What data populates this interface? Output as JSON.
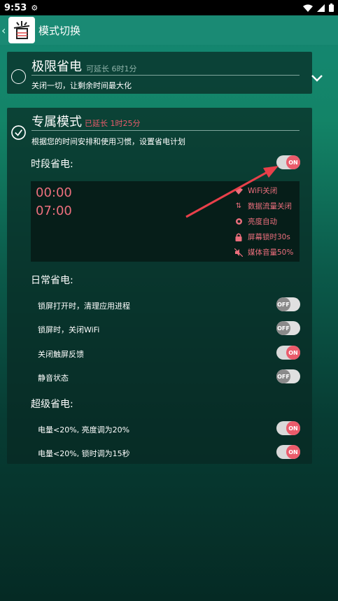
{
  "status": {
    "time": "9:53",
    "icons": [
      "gear-icon",
      "wifi-icon",
      "signal-icon",
      "battery-icon"
    ]
  },
  "appbar": {
    "title": "模式切换",
    "back_icon": "chevron-left-icon"
  },
  "modes": [
    {
      "title": "极限省电",
      "extend": "可延长 6时1分",
      "desc": "关闭一切，让剩余时间最大化",
      "selected": false
    },
    {
      "title": "专属模式",
      "extend": "已延长 1时25分",
      "desc": "根据您的时间安排和使用习惯，设置省电计划",
      "selected": true
    }
  ],
  "schedule_section": {
    "label": "时段省电:",
    "toggle": "ON",
    "start": "00:00",
    "end": "07:00",
    "features": [
      {
        "icon": "wifi-off-icon",
        "label": "WiFi关闭"
      },
      {
        "icon": "data-transfer-icon",
        "label": "数据流量关闭"
      },
      {
        "icon": "brightness-icon",
        "label": "亮度自动"
      },
      {
        "icon": "lock-icon",
        "label": "屏幕锁时30s"
      },
      {
        "icon": "mute-icon",
        "label": "媒体音量50%"
      }
    ]
  },
  "daily_section": {
    "label": "日常省电:",
    "items": [
      {
        "label": "锁屏打开时，清理应用进程",
        "state": "OFF"
      },
      {
        "label": "锁屏时，关闭WiFi",
        "state": "OFF"
      },
      {
        "label": "关闭触屏反馈",
        "state": "ON"
      },
      {
        "label": "静音状态",
        "state": "OFF"
      }
    ]
  },
  "super_section": {
    "label": "超级省电:",
    "items": [
      {
        "label": "电量<20%, 亮度调为20%",
        "state": "ON"
      },
      {
        "label": "电量<20%, 锁时调为15秒",
        "state": "ON"
      }
    ]
  },
  "colors": {
    "accent": "#ea5b6b",
    "appbar": "#1a8a74",
    "card": "#082822",
    "annotation_arrow": "#e8404a"
  }
}
